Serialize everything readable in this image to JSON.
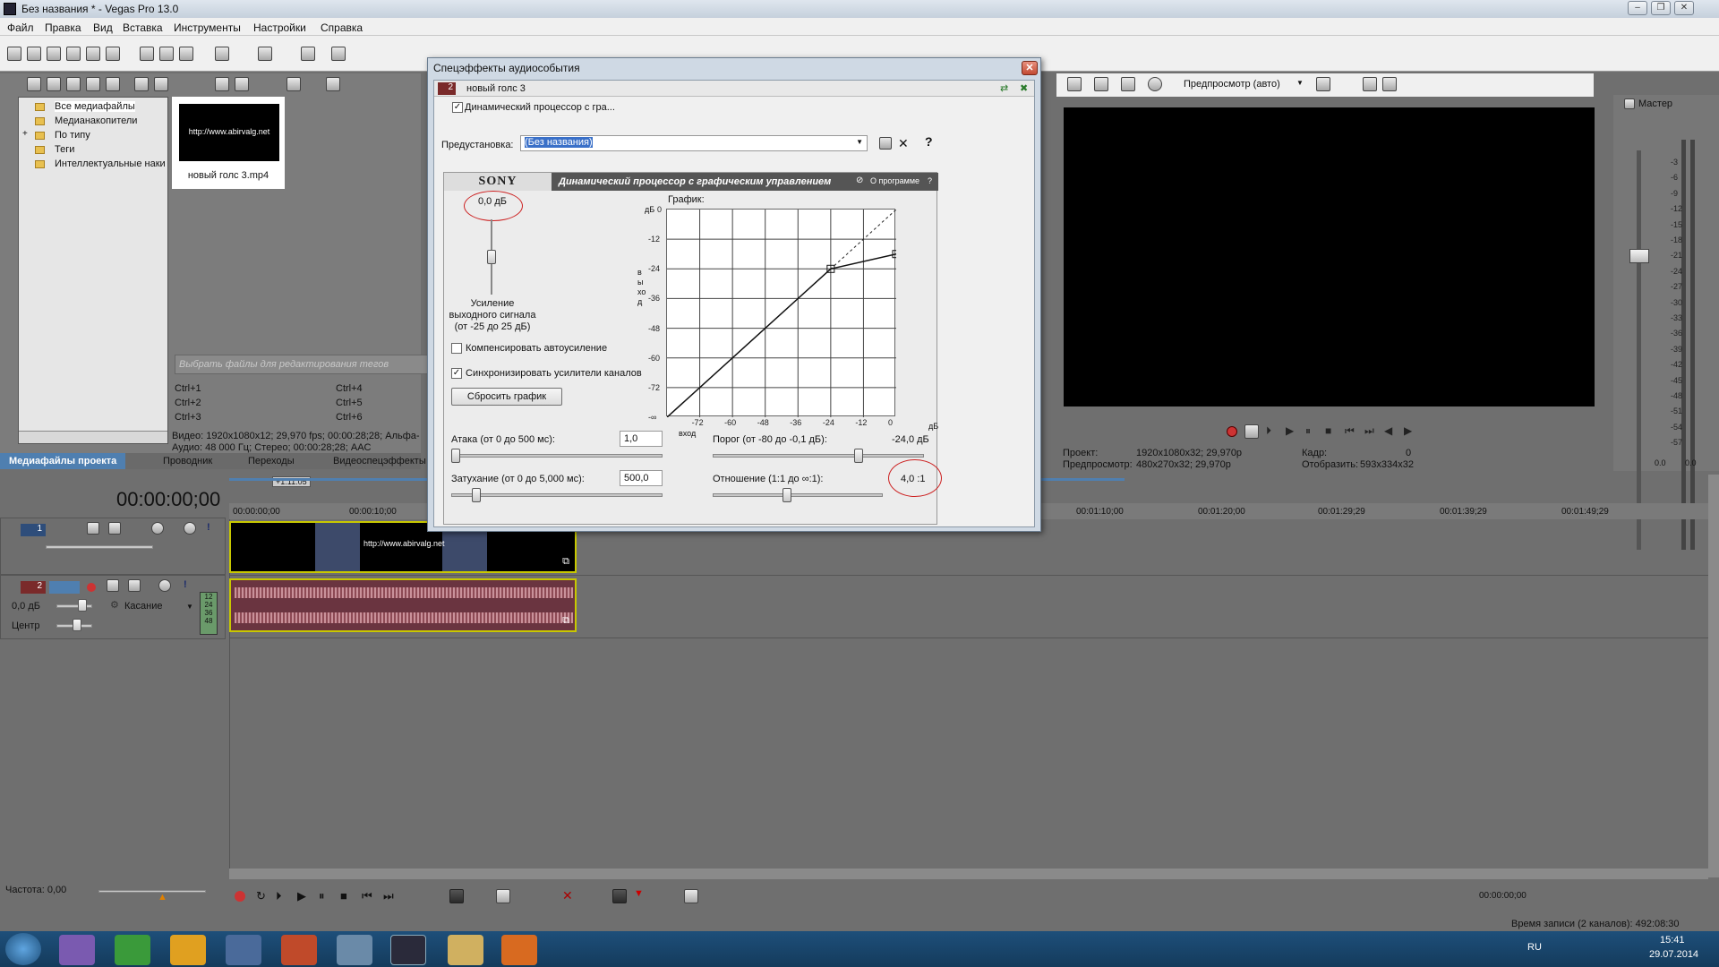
{
  "window": {
    "title": "Без названия * - Vegas Pro 13.0"
  },
  "menu": [
    "Файл",
    "Правка",
    "Вид",
    "Вставка",
    "Инструменты",
    "Настройки",
    "Справка"
  ],
  "explorer": {
    "tree": [
      "Все медиафайлы",
      "Медианакопители",
      "По типу",
      "Теги",
      "Интеллектуальные наки"
    ],
    "media_file": "новый голс 3.mp4",
    "thumb_text": "http://www.abirvalg.net",
    "tag_placeholder": "Выбрать файлы для редактирования тегов",
    "shortcuts": [
      "Ctrl+1",
      "Ctrl+4",
      "Ctrl+2",
      "Ctrl+5",
      "Ctrl+3",
      "Ctrl+6"
    ],
    "info_video": "Видео: 1920x1080x12; 29,970 fps; 00:00:28;28; Альфа-",
    "info_audio": "Аудио: 48 000 Гц; Стерео; 00:00:28;28; AAC",
    "tabs": [
      "Медиафайлы проекта",
      "Проводник",
      "Переходы",
      "Видеоспецэффекты"
    ]
  },
  "dialog": {
    "title": "Спецэффекты аудиособытия",
    "track_num": "2",
    "track_name": "новый голс 3",
    "chain_item": "Динамический процессор с гра...",
    "preset_label": "Предустановка:",
    "preset_value": "(Без названия)",
    "help": "?",
    "plugin_logo": "SONY",
    "plugin_name": "Динамический процессор с графическим управлением",
    "about": "О программе",
    "gain_value": "0,0 дБ",
    "gain_label": "Усиление выходного сигнала",
    "gain_range": "(от -25 до 25 дБ)",
    "compensate_label": "Компенсировать автоусиление",
    "compensate_checked": false,
    "sync_label": "Синхронизировать усилители каналов",
    "sync_checked": true,
    "reset_button": "Сбросить график",
    "graph_label": "График:",
    "graph_ylabel": "выход",
    "graph_xlabel": "вход",
    "graph_yunit": "дБ",
    "graph_xunit": "дБ",
    "graph_yticks": [
      "0",
      "-12",
      "-24",
      "-36",
      "-48",
      "-60",
      "-72",
      "-∞"
    ],
    "graph_xticks": [
      "-72",
      "-60",
      "-48",
      "-36",
      "-24",
      "-12",
      "0"
    ],
    "attack_label": "Атака (от 0 до 500 мс):",
    "attack_value": "1,0",
    "release_label": "Затухание (от 0 до 5,000 мс):",
    "release_value": "500,0",
    "threshold_label": "Порог (от -80 до -0,1 дБ):",
    "threshold_value": "-24,0 дБ",
    "ratio_label": "Отношение (1:1 до ∞:1):",
    "ratio_value": "4,0 :1",
    "slider_levels": {
      "gain_db": 0.0,
      "attack_ms": 1.0,
      "release_ms": 500.0,
      "threshold_db": -24.0
    }
  },
  "preview": {
    "mode": "Предпросмотр (авто)",
    "project_label": "Проект:",
    "project_value": "1920x1080x32; 29,970p",
    "preview_label": "Предпросмотр:",
    "preview_value": "480x270x32; 29,970p",
    "frame_label": "Кадр:",
    "frame_value": "0",
    "display_label": "Отобразить:",
    "display_value": "593x334x32"
  },
  "mixer": {
    "title": "Мастер",
    "scale": [
      "-3",
      "-6",
      "-9",
      "-12",
      "-15",
      "-18",
      "-21",
      "-24",
      "-27",
      "-30",
      "-33",
      "-36",
      "-39",
      "-42",
      "-45",
      "-48",
      "-51",
      "-54",
      "-57"
    ],
    "readout_left": "0.0",
    "readout_right": "0.0"
  },
  "timeline": {
    "timecode": "00:00:00;00",
    "cursor_marker": "+1:11:05",
    "ruler": [
      "00:00:00;00",
      "00:00:10;00",
      "00:01:10;00",
      "00:01:20;00",
      "00:01:29;29",
      "00:01:39;29",
      "00:01:49;29"
    ],
    "track1_num": "1",
    "track2_num": "2",
    "track2_volume": "0,0 дБ",
    "track2_mode": "Касание",
    "track2_pan": "Центр",
    "clip_text": "http://www.abirvalg.net",
    "meter_ticks": [
      "12",
      "24",
      "36",
      "48"
    ],
    "rate_label": "Частота: 0,00",
    "transport_time": "00:00:00;00",
    "record_time": "Время записи (2 каналов): 492:08:30"
  },
  "taskbar": {
    "lang": "RU",
    "time": "15:41",
    "date": "29.07.2014"
  }
}
